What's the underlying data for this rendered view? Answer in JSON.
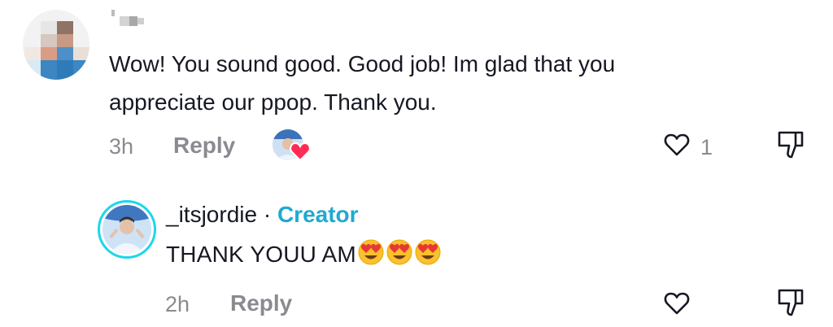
{
  "comment": {
    "text": "Wow! You sound good. Good job! Im glad that you appreciate our ppop. Thank you.",
    "time": "3h",
    "reply_label": "Reply",
    "like_count": "1"
  },
  "reply": {
    "username": "_itsjordie",
    "separator": "·",
    "badge": "Creator",
    "text": "THANK YOUU AM",
    "emojis": [
      "heart-eyes",
      "heart-eyes",
      "heart-eyes"
    ],
    "time": "2h",
    "reply_label": "Reply"
  },
  "colors": {
    "text": "#161823",
    "muted": "#8a8b91",
    "creator": "#20a9d1",
    "ring": "#20d5ec",
    "heart": "#fe2c55"
  }
}
